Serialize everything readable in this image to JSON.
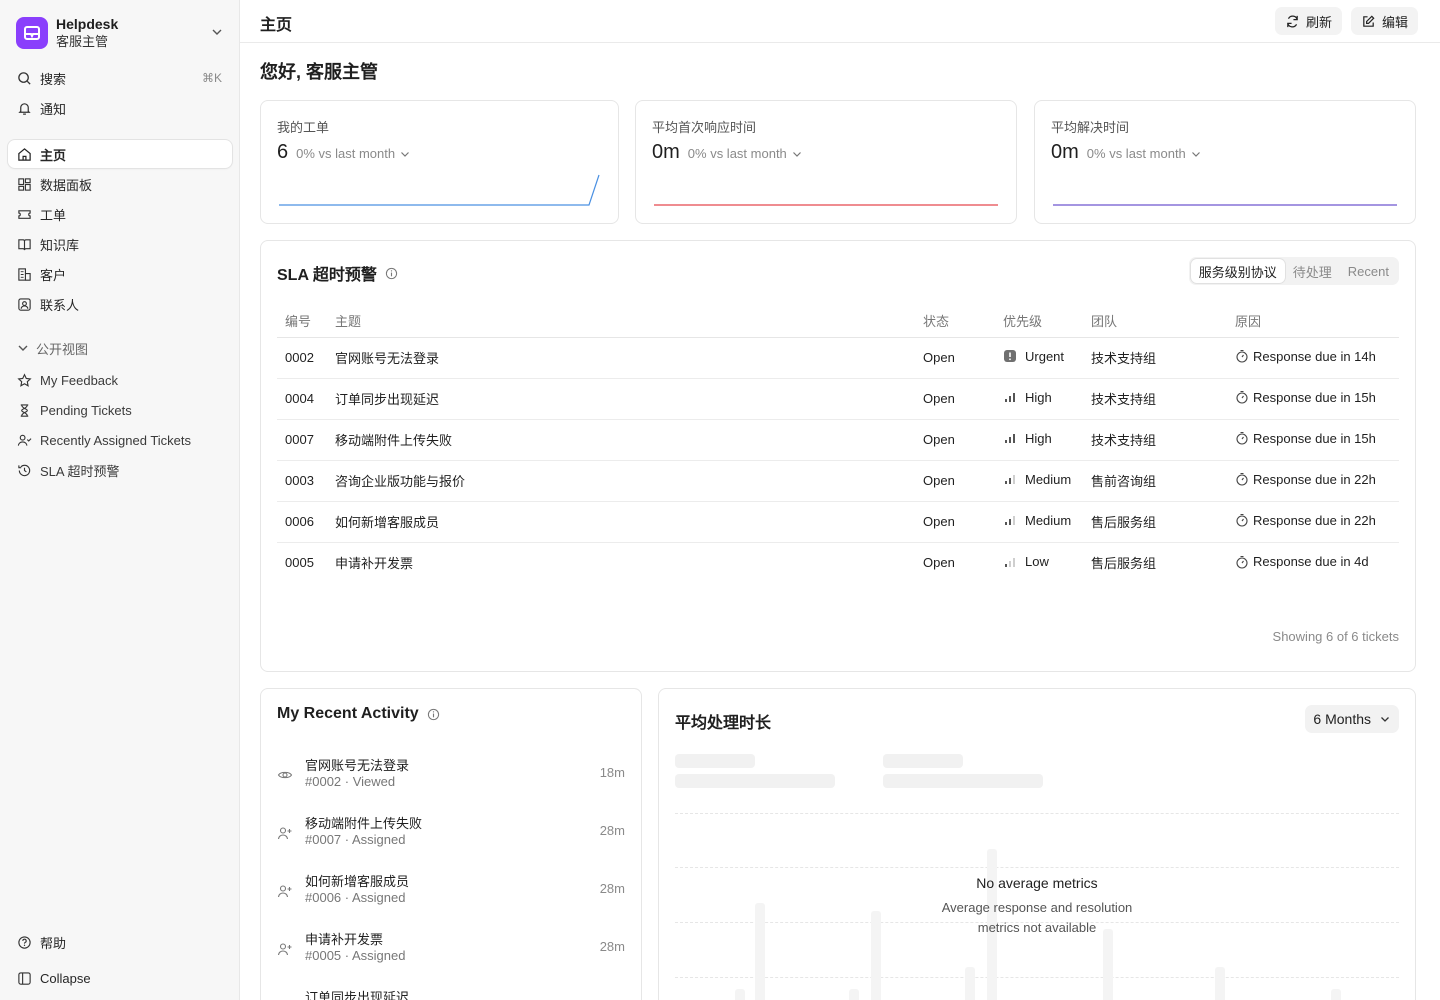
{
  "brand": {
    "title": "Helpdesk",
    "subtitle": "客服主管",
    "accent": "#8a3ffc"
  },
  "sidebar": {
    "search_label": "搜索",
    "search_shortcut": "⌘K",
    "notifications_label": "通知",
    "nav": [
      "主页",
      "数据面板",
      "工单",
      "知识库",
      "客户",
      "联系人"
    ],
    "section_label": "公开视图",
    "views": [
      "My Feedback",
      "Pending Tickets",
      "Recently Assigned Tickets",
      "SLA 超时预警"
    ],
    "help_label": "帮助",
    "collapse_label": "Collapse"
  },
  "header": {
    "title": "主页",
    "refresh_label": "刷新",
    "edit_label": "编辑"
  },
  "greeting": "您好, 客服主管",
  "metrics": [
    {
      "label": "我的工单",
      "value": "6",
      "delta": "0% vs last month",
      "color": "#4a90e2"
    },
    {
      "label": "平均首次响应时间",
      "value": "0m",
      "delta": "0% vs last month",
      "color": "#e5484d"
    },
    {
      "label": "平均解决时间",
      "value": "0m",
      "delta": "0% vs last month",
      "color": "#6e56cf"
    }
  ],
  "sla": {
    "title": "SLA 超时预警",
    "tabs": [
      "服务级别协议",
      "待处理",
      "Recent"
    ],
    "columns": [
      "编号",
      "主题",
      "状态",
      "优先级",
      "团队",
      "原因"
    ],
    "rows": [
      {
        "id": "0002",
        "subject": "官网账号无法登录",
        "status": "Open",
        "priority": "Urgent",
        "team": "技术支持组",
        "reason": "Response due in 14h"
      },
      {
        "id": "0004",
        "subject": "订单同步出现延迟",
        "status": "Open",
        "priority": "High",
        "team": "技术支持组",
        "reason": "Response due in 15h"
      },
      {
        "id": "0007",
        "subject": "移动端附件上传失败",
        "status": "Open",
        "priority": "High",
        "team": "技术支持组",
        "reason": "Response due in 15h"
      },
      {
        "id": "0003",
        "subject": "咨询企业版功能与报价",
        "status": "Open",
        "priority": "Medium",
        "team": "售前咨询组",
        "reason": "Response due in 22h"
      },
      {
        "id": "0006",
        "subject": "如何新增客服成员",
        "status": "Open",
        "priority": "Medium",
        "team": "售后服务组",
        "reason": "Response due in 22h"
      },
      {
        "id": "0005",
        "subject": "申请补开发票",
        "status": "Open",
        "priority": "Low",
        "team": "售后服务组",
        "reason": "Response due in 4d"
      }
    ],
    "footer": "Showing 6 of 6 tickets"
  },
  "activity": {
    "title": "My Recent Activity",
    "items": [
      {
        "title": "官网账号无法登录",
        "sub": "#0002 · Viewed",
        "time": "18m",
        "icon": "eye-icon"
      },
      {
        "title": "移动端附件上传失败",
        "sub": "#0007 · Assigned",
        "time": "28m",
        "icon": "user-plus-icon"
      },
      {
        "title": "如何新增客服成员",
        "sub": "#0006 · Assigned",
        "time": "28m",
        "icon": "user-plus-icon"
      },
      {
        "title": "申请补开发票",
        "sub": "#0005 · Assigned",
        "time": "28m",
        "icon": "user-plus-icon"
      },
      {
        "title": "订单同步出现延迟",
        "sub": "",
        "time": "",
        "icon": "user-plus-icon"
      }
    ]
  },
  "avg": {
    "title": "平均处理时长",
    "period": "6 Months",
    "empty_title": "No average metrics",
    "empty_sub": "Average response and resolution metrics not available"
  }
}
